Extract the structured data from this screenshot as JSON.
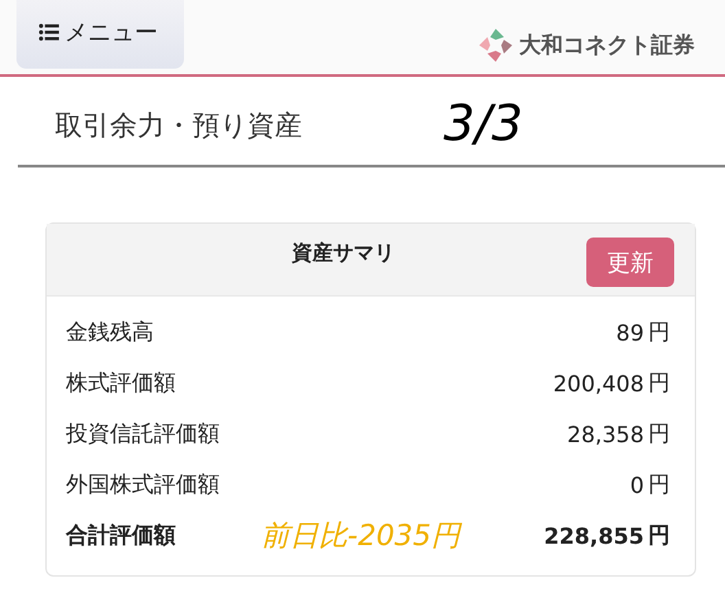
{
  "header": {
    "menu_button": {
      "label": "メニュー"
    },
    "logo": {
      "text": "大和コネクト証券"
    }
  },
  "page_title": "取引余力・預り資産",
  "annotations": [
    {
      "kind": "page",
      "text": "3/3"
    },
    {
      "kind": "note",
      "text": "前日比-2035円"
    }
  ],
  "card": {
    "title": "資産サマリ",
    "button": "更新",
    "rows": [
      {
        "kind": "item",
        "label": "金銭残高",
        "value": "89",
        "unit": "円"
      },
      {
        "kind": "item",
        "label": "株式評価額",
        "value": "200,408",
        "unit": "円"
      },
      {
        "kind": "item",
        "label": "投資信託評価額",
        "value": "28,358",
        "unit": "円"
      },
      {
        "kind": "item",
        "label": "外国株式評価額",
        "value": "0",
        "unit": "円"
      },
      {
        "kind": "total",
        "label": "合計評価額",
        "value": "228,855",
        "unit": "円"
      }
    ]
  }
}
